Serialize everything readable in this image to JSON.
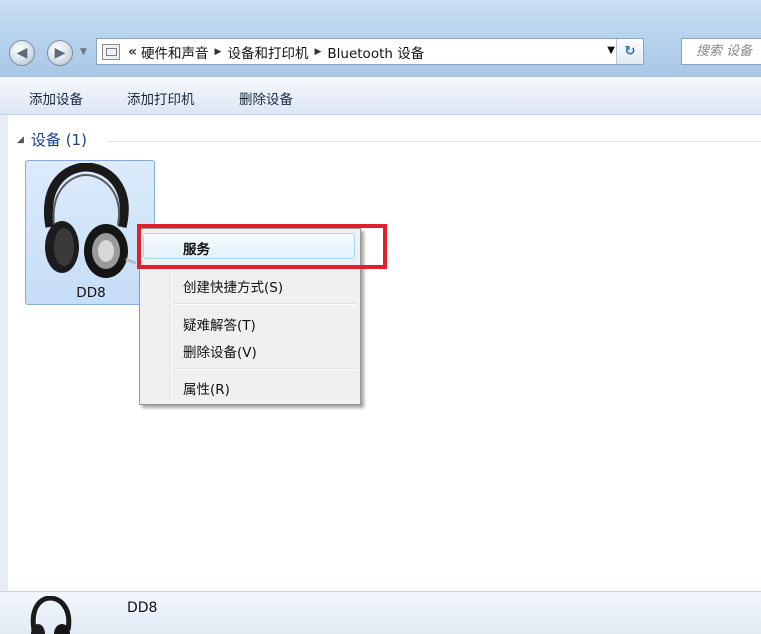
{
  "address": {
    "overflow_glyph": "«",
    "crumbs": [
      "硬件和声音",
      "设备和打印机",
      "Bluetooth 设备"
    ],
    "search_placeholder": "搜索 设备"
  },
  "toolbar": {
    "add_device": "添加设备",
    "add_printer": "添加打印机",
    "remove_device": "删除设备"
  },
  "group": {
    "title": "设备 (1)"
  },
  "device": {
    "name": "DD8"
  },
  "context_menu": {
    "items": [
      "服务",
      "创建快捷方式(S)",
      "疑难解答(T)",
      "删除设备(V)",
      "属性(R)"
    ]
  },
  "details": {
    "name": "DD8"
  },
  "colors": {
    "highlight_box": "#e0212b",
    "group_title": "#1a3e8a"
  }
}
